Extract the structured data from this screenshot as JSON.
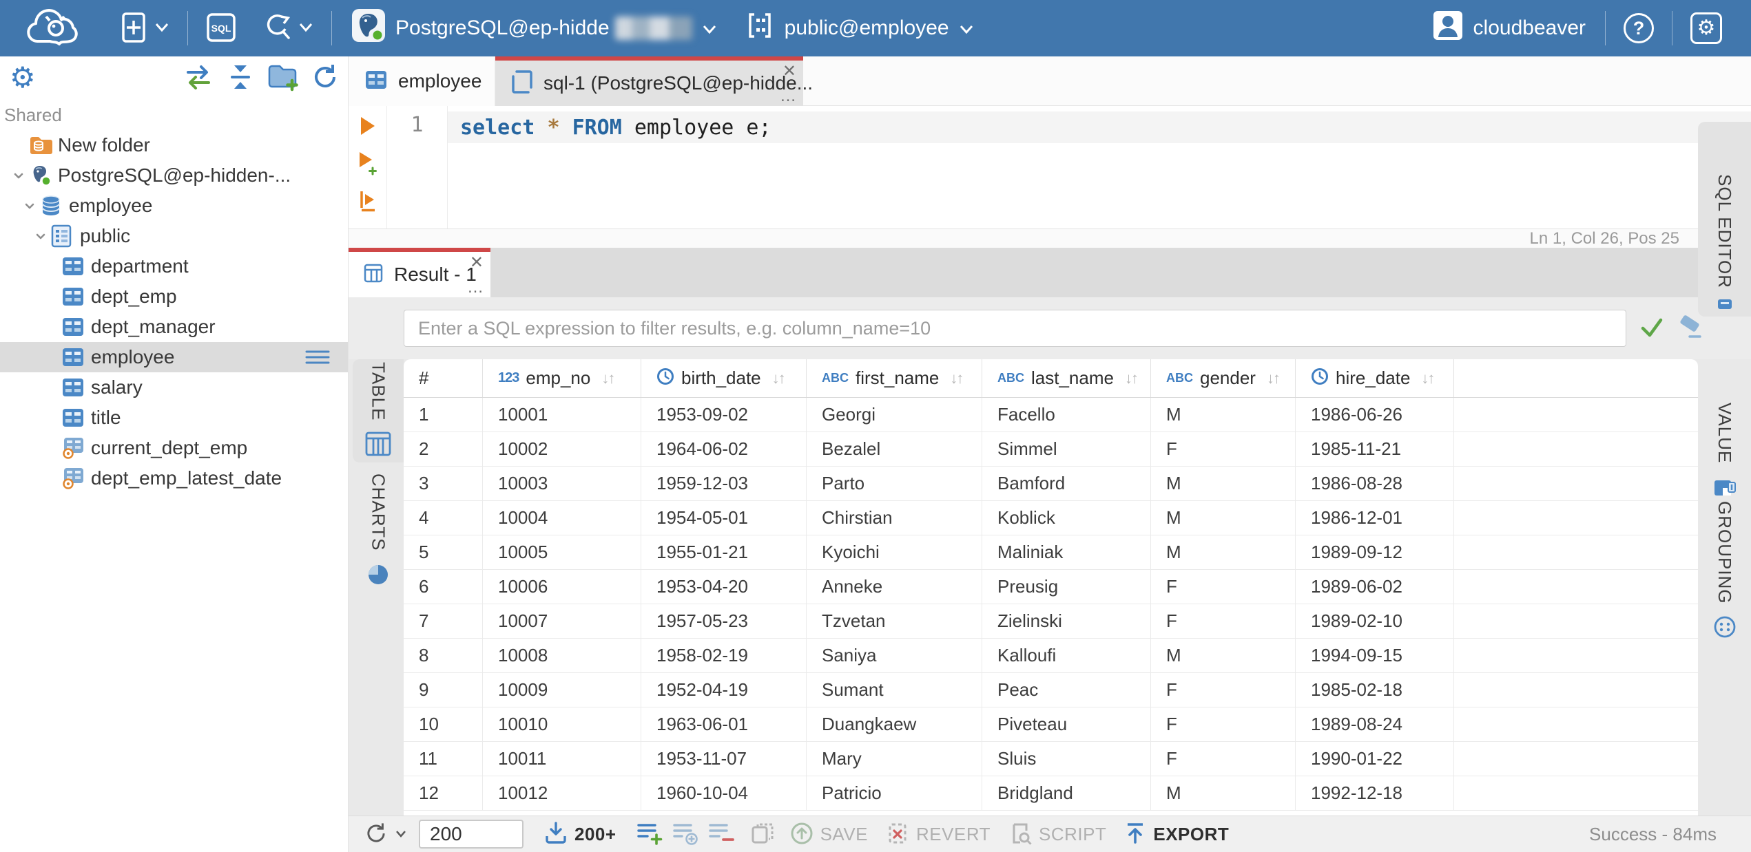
{
  "topbar": {
    "connection_label": "PostgreSQL@ep-hidde",
    "schema_label": "public@employee",
    "user_label": "cloudbeaver"
  },
  "icons": {
    "close": "✕",
    "more": "…",
    "sort_asc_desc": "↓↑",
    "help": "?",
    "settings_gear": "⚙",
    "number_type": "123",
    "string_type": "ABC"
  },
  "sidebar": {
    "section_label": "Shared",
    "tree": [
      {
        "label": "New folder",
        "icon": "folder-database",
        "level": 0,
        "expandable": false
      },
      {
        "label": "PostgreSQL@ep-hidden-...",
        "icon": "postgres",
        "level": 0,
        "expandable": true
      },
      {
        "label": "employee",
        "icon": "database",
        "level": 1,
        "expandable": true
      },
      {
        "label": "public",
        "icon": "schema",
        "level": 2,
        "expandable": true
      },
      {
        "label": "department",
        "icon": "table",
        "level": 3,
        "expandable": false
      },
      {
        "label": "dept_emp",
        "icon": "table",
        "level": 3,
        "expandable": false
      },
      {
        "label": "dept_manager",
        "icon": "table",
        "level": 3,
        "expandable": false
      },
      {
        "label": "employee",
        "icon": "table",
        "level": 3,
        "expandable": false,
        "selected": true
      },
      {
        "label": "salary",
        "icon": "table",
        "level": 3,
        "expandable": false
      },
      {
        "label": "title",
        "icon": "table",
        "level": 3,
        "expandable": false
      },
      {
        "label": "current_dept_emp",
        "icon": "view",
        "level": 3,
        "expandable": false
      },
      {
        "label": "dept_emp_latest_date",
        "icon": "view",
        "level": 3,
        "expandable": false
      }
    ]
  },
  "editor_tabs": {
    "employee_label": "employee",
    "sql_label": "sql-1 (PostgreSQL@ep-hidde..."
  },
  "editor": {
    "line_number": "1",
    "tokens": [
      {
        "text": "select",
        "type": "keyword"
      },
      {
        "text": " ",
        "type": "plain"
      },
      {
        "text": "*",
        "type": "operator"
      },
      {
        "text": " ",
        "type": "plain"
      },
      {
        "text": "FROM",
        "type": "keyword"
      },
      {
        "text": " employee e;",
        "type": "plain"
      }
    ],
    "status_text": "Ln 1, Col 26, Pos 25"
  },
  "result": {
    "tab_label": "Result - 1",
    "filter_placeholder": "Enter a SQL expression to filter results, e.g. column_name=10",
    "sql_editor_tab_label": "SQL EDITOR",
    "left_tabs": [
      {
        "label": "TABLE"
      },
      {
        "label": "CHARTS"
      }
    ],
    "right_tabs": [
      {
        "label": "VALUE"
      },
      {
        "label": "GROUPING"
      }
    ],
    "grid": {
      "row_number_header": "#",
      "columns": [
        {
          "name": "emp_no",
          "type": "number"
        },
        {
          "name": "birth_date",
          "type": "date"
        },
        {
          "name": "first_name",
          "type": "string"
        },
        {
          "name": "last_name",
          "type": "string"
        },
        {
          "name": "gender",
          "type": "string"
        },
        {
          "name": "hire_date",
          "type": "date"
        }
      ],
      "rows": [
        [
          "1",
          "10001",
          "1953-09-02",
          "Georgi",
          "Facello",
          "M",
          "1986-06-26"
        ],
        [
          "2",
          "10002",
          "1964-06-02",
          "Bezalel",
          "Simmel",
          "F",
          "1985-11-21"
        ],
        [
          "3",
          "10003",
          "1959-12-03",
          "Parto",
          "Bamford",
          "M",
          "1986-08-28"
        ],
        [
          "4",
          "10004",
          "1954-05-01",
          "Chirstian",
          "Koblick",
          "M",
          "1986-12-01"
        ],
        [
          "5",
          "10005",
          "1955-01-21",
          "Kyoichi",
          "Maliniak",
          "M",
          "1989-09-12"
        ],
        [
          "6",
          "10006",
          "1953-04-20",
          "Anneke",
          "Preusig",
          "F",
          "1989-06-02"
        ],
        [
          "7",
          "10007",
          "1957-05-23",
          "Tzvetan",
          "Zielinski",
          "F",
          "1989-02-10"
        ],
        [
          "8",
          "10008",
          "1958-02-19",
          "Saniya",
          "Kalloufi",
          "M",
          "1994-09-15"
        ],
        [
          "9",
          "10009",
          "1952-04-19",
          "Sumant",
          "Peac",
          "F",
          "1985-02-18"
        ],
        [
          "10",
          "10010",
          "1963-06-01",
          "Duangkaew",
          "Piveteau",
          "F",
          "1989-08-24"
        ],
        [
          "11",
          "10011",
          "1953-11-07",
          "Mary",
          "Sluis",
          "F",
          "1990-01-22"
        ],
        [
          "12",
          "10012",
          "1960-10-04",
          "Patricio",
          "Bridgland",
          "M",
          "1992-12-18"
        ]
      ]
    },
    "toolbar": {
      "rows_limit_value": "200",
      "load_more_label": "200+",
      "save_label": "SAVE",
      "revert_label": "REVERT",
      "script_label": "SCRIPT",
      "export_label": "EXPORT",
      "status_text": "Success - 84ms"
    }
  },
  "colors": {
    "topbar_blue": "#4177ad",
    "accent_blue": "#3f7ec1",
    "active_tab_border_red": "#cf4747",
    "success_green": "#5ea648",
    "run_orange": "#e8821e",
    "folder_orange": "#e8923d"
  }
}
